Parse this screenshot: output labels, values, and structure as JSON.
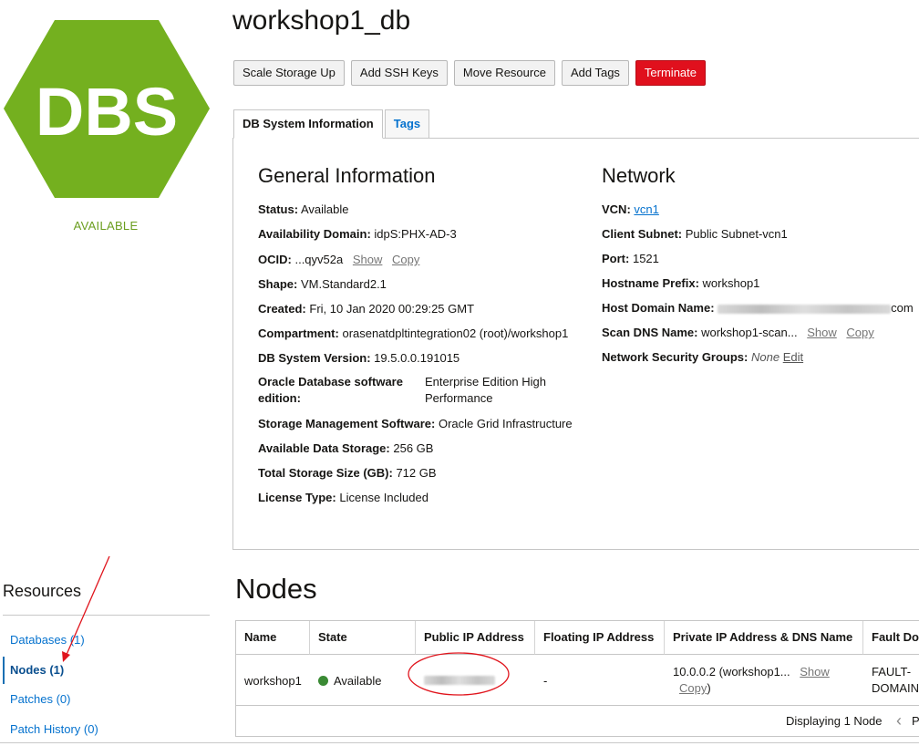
{
  "page": {
    "title": "workshop1_db",
    "logo_text": "DBS",
    "status": "AVAILABLE"
  },
  "toolbar": {
    "scale_storage": "Scale Storage Up",
    "add_ssh": "Add SSH Keys",
    "move_resource": "Move Resource",
    "add_tags": "Add Tags",
    "terminate": "Terminate"
  },
  "tabs": {
    "db_info": "DB System Information",
    "tags": "Tags"
  },
  "general": {
    "title": "General Information",
    "status_k": "Status:",
    "status_v": "Available",
    "ad_k": "Availability Domain:",
    "ad_v": "idpS:PHX-AD-3",
    "ocid_k": "OCID:",
    "ocid_v": "...qyv52a",
    "show": "Show",
    "copy": "Copy",
    "shape_k": "Shape:",
    "shape_v": "VM.Standard2.1",
    "created_k": "Created:",
    "created_v": "Fri, 10 Jan 2020 00:29:25 GMT",
    "compartment_k": "Compartment:",
    "compartment_v": "orasenatdpltintegration02 (root)/workshop1",
    "version_k": "DB System Version:",
    "version_v": "19.5.0.0.191015",
    "edition_k": "Oracle Database software edition:",
    "edition_v": "Enterprise Edition High Performance",
    "storage_mgmt_k": "Storage Management Software:",
    "storage_mgmt_v": "Oracle Grid Infrastructure",
    "avail_storage_k": "Available Data Storage:",
    "avail_storage_v": "256 GB",
    "total_storage_k": "Total Storage Size (GB):",
    "total_storage_v": "712 GB",
    "license_k": "License Type:",
    "license_v": "License Included"
  },
  "network": {
    "title": "Network",
    "vcn_k": "VCN:",
    "vcn_v": "vcn1",
    "subnet_k": "Client Subnet:",
    "subnet_v": "Public Subnet-vcn1",
    "port_k": "Port:",
    "port_v": "1521",
    "hostname_k": "Hostname Prefix:",
    "hostname_v": "workshop1",
    "domain_k": "Host Domain Name:",
    "domain_suffix": "com",
    "scan_k": "Scan DNS Name:",
    "scan_v": "workshop1-scan...",
    "show": "Show",
    "copy": "Copy",
    "nsg_k": "Network Security Groups:",
    "nsg_v": "None",
    "edit": "Edit"
  },
  "resources": {
    "title": "Resources",
    "items": [
      "Databases (1)",
      "Nodes (1)",
      "Patches (0)",
      "Patch History (0)"
    ]
  },
  "nodes": {
    "title": "Nodes",
    "headers": [
      "Name",
      "State",
      "Public IP Address",
      "Floating IP Address",
      "Private IP Address & DNS Name",
      "Fault Do"
    ],
    "row": {
      "name": "workshop1",
      "state": "Available",
      "floating_ip": "-",
      "private_ip": "10.0.0.2 (workshop1...",
      "show": "Show",
      "copy": "Copy",
      "fault_domain_1": "FAULT-",
      "fault_domain_2": "DOMAIN-"
    },
    "footer": "Displaying 1 Node",
    "pager_prev": "‹",
    "pager_next": "P"
  },
  "colors": {
    "logo_green": "#6fad1e",
    "danger": "#e0101d",
    "link": "#0572ce",
    "annotation": "#e0141c"
  }
}
